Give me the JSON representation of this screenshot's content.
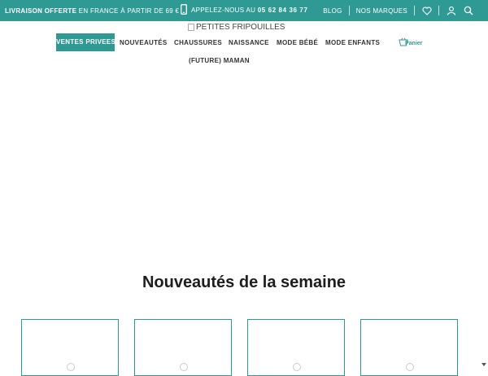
{
  "topbar": {
    "promo_bold": "LIVRAISON OFFERTE",
    "promo_rest": " EN FRANCE À PARTIR DE 69 €",
    "phone_label": "APPELEZ-NOUS AU ",
    "phone_number": "05 62 84 36 77",
    "blog": "BLOG",
    "brands": "NOS MARQUES",
    "icons": [
      "phone-icon",
      "heart-icon",
      "user-icon",
      "search-icon"
    ]
  },
  "logo": {
    "alt": "PETITES FRIPOUILLES"
  },
  "nav": {
    "items": [
      {
        "label": "VENTES PRIVEES"
      },
      {
        "label": "NOUVEAUTÉS"
      },
      {
        "label": "CHAUSSURES"
      },
      {
        "label": "NAISSANCE"
      },
      {
        "label": "MODE BÉBÉ"
      },
      {
        "label": "MODE ENFANTS"
      },
      {
        "label": "(FUTURE) MAMAN"
      }
    ],
    "cart_label": "Panier"
  },
  "section": {
    "title": "Nouveautés de la semaine"
  },
  "colors": {
    "accent": "#2f9a93"
  }
}
